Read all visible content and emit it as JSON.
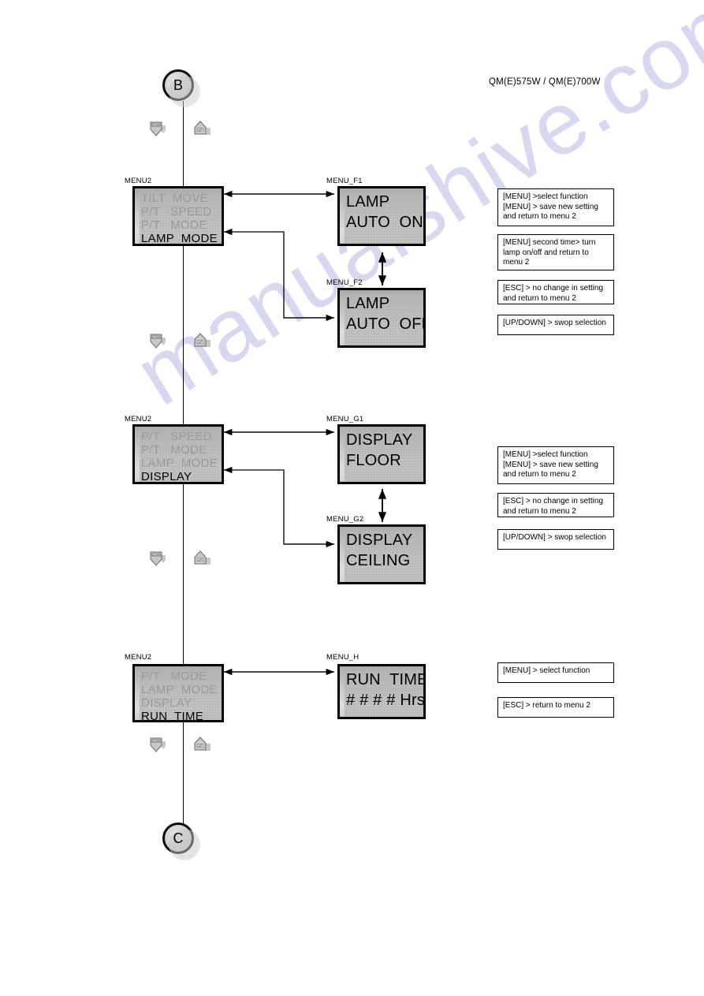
{
  "document": {
    "header": "QM(E)575W / QM(E)700W",
    "watermark": "manualshive.com"
  },
  "connectors": {
    "top": {
      "label": "B",
      "name": "connector-b"
    },
    "bottom": {
      "label": "C",
      "name": "connector-c"
    }
  },
  "keys": {
    "down": "DOWN",
    "up": "UP"
  },
  "sections": [
    {
      "id": "lamp-mode",
      "menu_label": "MENU2",
      "menu_lines": [
        {
          "text": "TILT  MOVE",
          "selected": false
        },
        {
          "text": "P/T   SPEED",
          "selected": false
        },
        {
          "text": "P/T   MODE",
          "selected": false
        },
        {
          "text": "LAMP  MODE",
          "selected": true
        }
      ],
      "targets": [
        {
          "label": "MENU_F1",
          "lines": [
            "LAMP",
            "AUTO  ON"
          ]
        },
        {
          "label": "MENU_F2",
          "lines": [
            "LAMP",
            "AUTO  OFF"
          ]
        }
      ],
      "notes": [
        [
          "[MENU] >select function",
          "[MENU] > save new setting",
          "and return to menu 2"
        ],
        [
          "[MENU] second time> turn",
          "lamp on/off and return to",
          " menu 2"
        ],
        [
          "[ESC] > no change in setting",
          "and return to menu 2"
        ],
        [
          "[UP/DOWN] > swop selection"
        ]
      ]
    },
    {
      "id": "display",
      "menu_label": "MENU2",
      "menu_lines": [
        {
          "text": "P/T   SPEED",
          "selected": false
        },
        {
          "text": "P/T   MODE",
          "selected": false
        },
        {
          "text": "LAMP  MODE",
          "selected": false
        },
        {
          "text": "DISPLAY",
          "selected": true
        }
      ],
      "targets": [
        {
          "label": "MENU_G1",
          "lines": [
            "DISPLAY",
            "FLOOR"
          ]
        },
        {
          "label": "MENU_G2",
          "lines": [
            "DISPLAY",
            "CEILING"
          ]
        }
      ],
      "notes": [
        [
          "[MENU] >select function",
          "[MENU] > save new setting",
          "and return to menu 2"
        ],
        [
          "[ESC] > no change in setting",
          "and return to menu 2"
        ],
        [
          "[UP/DOWN] > swop selection"
        ]
      ]
    },
    {
      "id": "run-time",
      "menu_label": "MENU2",
      "menu_lines": [
        {
          "text": "P/T   MODE",
          "selected": false
        },
        {
          "text": "LAMP  MODE",
          "selected": false
        },
        {
          "text": "DISPLAY",
          "selected": false
        },
        {
          "text": "RUN  TIME",
          "selected": true
        }
      ],
      "targets": [
        {
          "label": "MENU_H",
          "lines": [
            "RUN  TIME",
            "# # # # Hrs"
          ]
        }
      ],
      "notes": [
        [
          "[MENU] > select function"
        ],
        [
          "[ESC] > return to menu 2"
        ]
      ]
    }
  ]
}
